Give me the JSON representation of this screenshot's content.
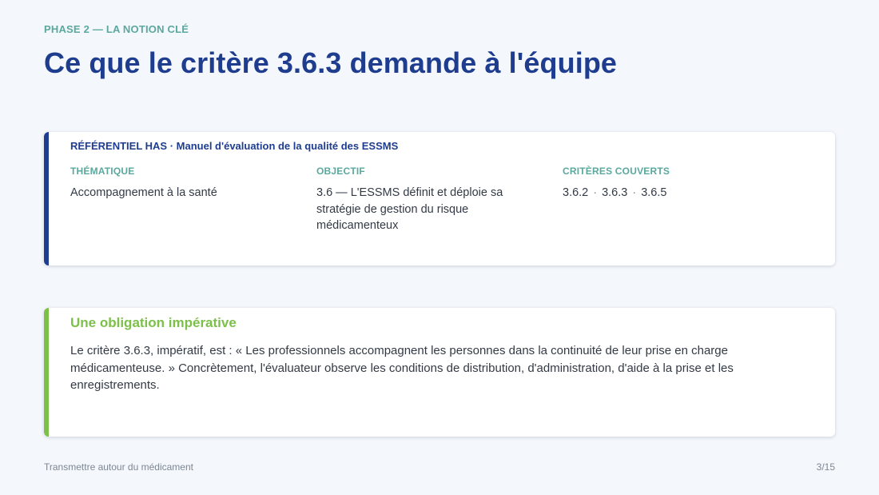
{
  "header": {
    "kicker": "PHASE 2 — LA NOTION CLÉ",
    "title": "Ce que le critère 3.6.3 demande à l'équipe"
  },
  "referentiel": {
    "heading": "RÉFÉRENTIEL HAS · Manuel d'évaluation de la qualité des ESSMS",
    "columns": [
      {
        "label": "THÉMATIQUE",
        "value": "Accompagnement à la santé"
      },
      {
        "label": "OBJECTIF",
        "value": "3.6 — L'ESSMS définit et déploie sa stratégie de gestion du risque médicamenteux"
      },
      {
        "label": "CRITÈRES COUVERTS",
        "criteria": [
          "3.6.2",
          "3.6.3",
          "3.6.5"
        ],
        "separator": "·"
      }
    ]
  },
  "obligation": {
    "title": "Une obligation impérative",
    "text": "Le critère 3.6.3, impératif, est : « Les professionnels accompagnent les personnes dans la continuité de leur prise en charge médicamenteuse. » Concrètement, l'évaluateur observe les conditions de distribution, d'administration, d'aide à la prise et les enregistrements."
  },
  "footer": {
    "left": "Transmettre autour du médicament",
    "page": "3/15"
  },
  "colors": {
    "primary": "#1f3d8f",
    "teal": "#5aa89e",
    "green": "#7cc04a",
    "background": "#f4f7fb"
  }
}
